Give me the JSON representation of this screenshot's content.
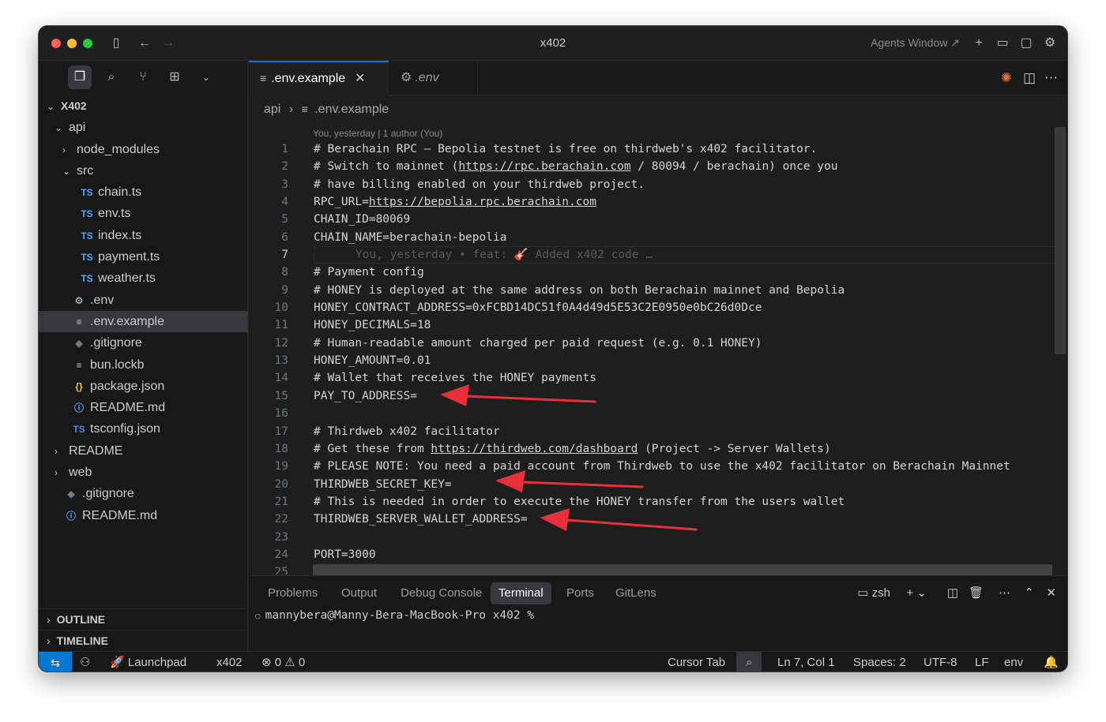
{
  "window": {
    "title": "x402",
    "agents_window": "Agents Window"
  },
  "sidebar": {
    "tree": [
      {
        "label": "X402",
        "depth": 0,
        "chev": "⌄",
        "icon": "",
        "icon_class": "",
        "bold": true
      },
      {
        "label": "api",
        "depth": 1,
        "chev": "⌄",
        "icon": "",
        "icon_class": ""
      },
      {
        "label": "node_modules",
        "depth": 2,
        "chev": "›",
        "icon": "",
        "icon_class": ""
      },
      {
        "label": "src",
        "depth": 2,
        "chev": "⌄",
        "icon": "",
        "icon_class": ""
      },
      {
        "label": "chain.ts",
        "depth": 3,
        "chev": "",
        "icon": "TS",
        "icon_class": "ts"
      },
      {
        "label": "env.ts",
        "depth": 3,
        "chev": "",
        "icon": "TS",
        "icon_class": "ts"
      },
      {
        "label": "index.ts",
        "depth": 3,
        "chev": "",
        "icon": "TS",
        "icon_class": "ts"
      },
      {
        "label": "payment.ts",
        "depth": 3,
        "chev": "",
        "icon": "TS",
        "icon_class": "ts"
      },
      {
        "label": "weather.ts",
        "depth": 3,
        "chev": "",
        "icon": "TS",
        "icon_class": "ts"
      },
      {
        "label": ".env",
        "depth": 2,
        "chev": "",
        "icon": "⚙",
        "icon_class": "gear"
      },
      {
        "label": ".env.example",
        "depth": 2,
        "chev": "",
        "icon": "≡",
        "icon_class": "lines",
        "selected": true
      },
      {
        "label": ".gitignore",
        "depth": 2,
        "chev": "",
        "icon": "◆",
        "icon_class": "git"
      },
      {
        "label": "bun.lockb",
        "depth": 2,
        "chev": "",
        "icon": "≡",
        "icon_class": "lines"
      },
      {
        "label": "package.json",
        "depth": 2,
        "chev": "",
        "icon": "{}",
        "icon_class": "braces"
      },
      {
        "label": "README.md",
        "depth": 2,
        "chev": "",
        "icon": "ⓘ",
        "icon_class": "info"
      },
      {
        "label": "tsconfig.json",
        "depth": 2,
        "chev": "",
        "icon": "TS",
        "icon_class": "tsc"
      },
      {
        "label": "README",
        "depth": 1,
        "chev": "›",
        "icon": "",
        "icon_class": ""
      },
      {
        "label": "web",
        "depth": 1,
        "chev": "›",
        "icon": "",
        "icon_class": ""
      },
      {
        "label": ".gitignore",
        "depth": 1,
        "chev": "",
        "icon": "◆",
        "icon_class": "git"
      },
      {
        "label": "README.md",
        "depth": 1,
        "chev": "",
        "icon": "ⓘ",
        "icon_class": "info"
      }
    ],
    "outline": "OUTLINE",
    "timeline": "TIMELINE"
  },
  "tabs": [
    {
      "label": ".env.example",
      "active": true
    },
    {
      "label": ".env",
      "active": false
    }
  ],
  "breadcrumb": {
    "folder": "api",
    "sep": "›",
    "file": ".env.example"
  },
  "blame": "You, yesterday | 1 author (You)",
  "code": [
    {
      "n": "1",
      "t": "# Berachain RPC — Bepolia testnet is free on thirdweb's x402 facilitator."
    },
    {
      "n": "2",
      "t": "# Switch to mainnet (",
      "u": "https://rpc.berachain.com",
      "a": " / 80094 / berachain) once you"
    },
    {
      "n": "3",
      "t": "# have billing enabled on your thirdweb project."
    },
    {
      "n": "4",
      "t": "RPC_URL=",
      "u": "https://bepolia.rpc.berachain.com",
      "a": ""
    },
    {
      "n": "5",
      "t": "CHAIN_ID=80069"
    },
    {
      "n": "6",
      "t": "CHAIN_NAME=berachain-bepolia"
    },
    {
      "n": "7",
      "t": "",
      "ghost": "You, yesterday • feat: 🎸 Added x402 code …",
      "current": true
    },
    {
      "n": "8",
      "t": "# Payment config"
    },
    {
      "n": "9",
      "t": "# HONEY is deployed at the same address on both Berachain mainnet and Bepolia"
    },
    {
      "n": "10",
      "t": "HONEY_CONTRACT_ADDRESS=0xFCBD14DC51f0A4d49d5E53C2E0950e0bC26d0Dce"
    },
    {
      "n": "11",
      "t": "HONEY_DECIMALS=18"
    },
    {
      "n": "12",
      "t": "# Human-readable amount charged per paid request (e.g. 0.1 HONEY)"
    },
    {
      "n": "13",
      "t": "HONEY_AMOUNT=0.01"
    },
    {
      "n": "14",
      "t": "# Wallet that receives the HONEY payments"
    },
    {
      "n": "15",
      "t": "PAY_TO_ADDRESS="
    },
    {
      "n": "16",
      "t": ""
    },
    {
      "n": "17",
      "t": "# Thirdweb x402 facilitator"
    },
    {
      "n": "18",
      "t": "# Get these from ",
      "u": "https://thirdweb.com/dashboard",
      "a": " (Project -> Server Wallets)"
    },
    {
      "n": "19",
      "t": "# PLEASE NOTE: You need a paid account from Thirdweb to use the x402 facilitator on Berachain Mainnet"
    },
    {
      "n": "20",
      "t": "THIRDWEB_SECRET_KEY="
    },
    {
      "n": "21",
      "t": "# This is needed in order to execute the HONEY transfer from the users wallet"
    },
    {
      "n": "22",
      "t": "THIRDWEB_SERVER_WALLET_ADDRESS="
    },
    {
      "n": "23",
      "t": ""
    },
    {
      "n": "24",
      "t": "PORT=3000"
    },
    {
      "n": "25",
      "t": ""
    }
  ],
  "panel": {
    "tabs": [
      "Problems",
      "Output",
      "Debug Console",
      "Terminal",
      "Ports",
      "GitLens"
    ],
    "active_tab": "Terminal",
    "shell": "zsh",
    "prompt": "mannybera@Manny-Bera-MacBook-Pro x402 %"
  },
  "statusbar": {
    "launchpad": "Launchpad",
    "repo": "x402",
    "errors": "0",
    "warnings": "0",
    "cursor_tab": "Cursor Tab",
    "position": "Ln 7, Col 1",
    "spaces": "Spaces: 2",
    "encoding": "UTF-8",
    "eol": "LF",
    "language": "env"
  },
  "colors": {
    "accent": "#0078d4",
    "arrow": "#e8303a",
    "bg": "#1e1e1e"
  }
}
